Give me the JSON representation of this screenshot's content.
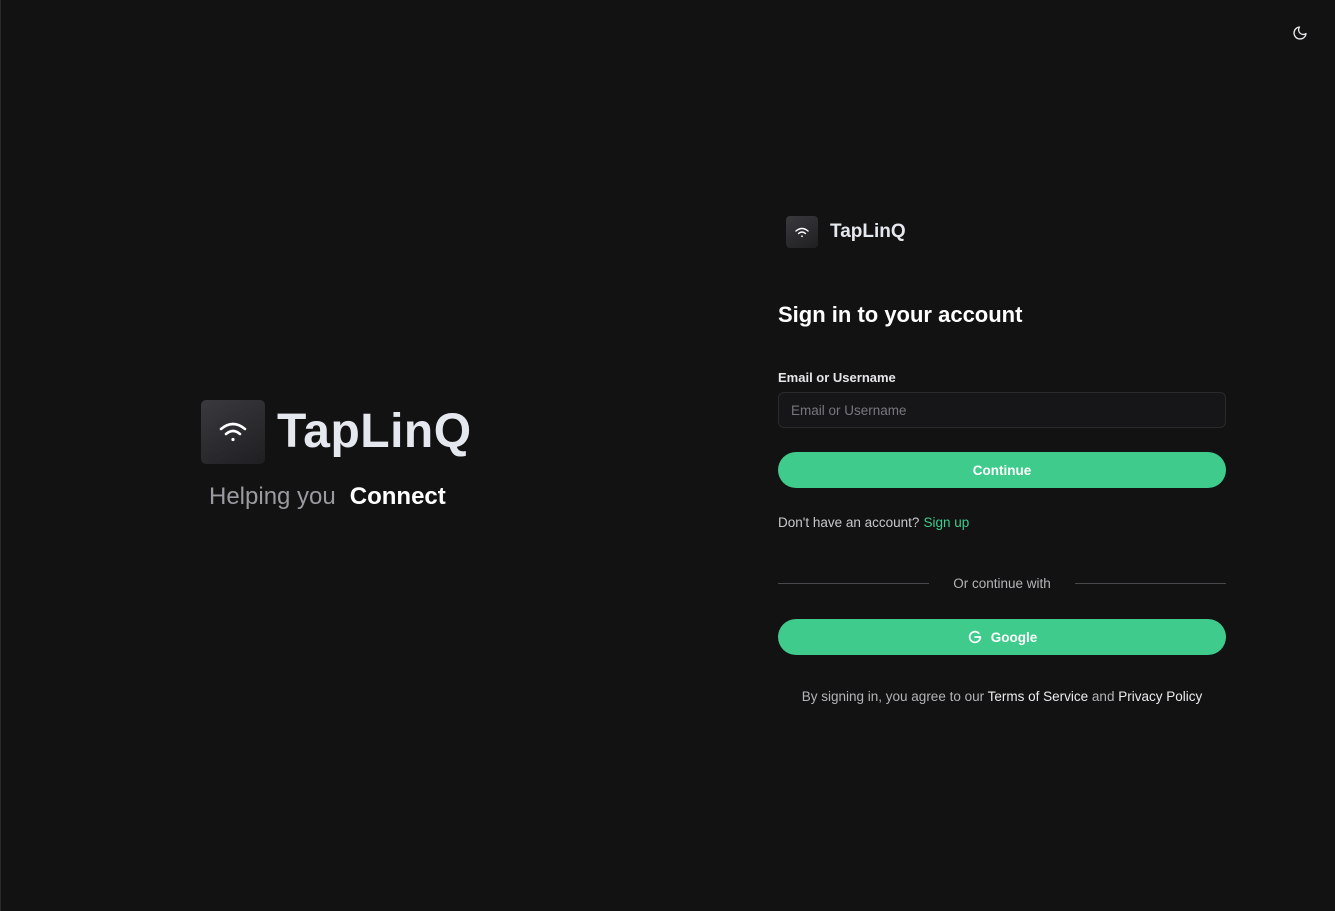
{
  "app": {
    "name": "TapLinQ"
  },
  "hero": {
    "tagline_muted": "Helping you",
    "tagline_strong": "Connect"
  },
  "form": {
    "title": "Sign in to your account",
    "field_label": "Email or Username",
    "field_placeholder": "Email or Username",
    "field_value": "",
    "continue_label": "Continue",
    "no_account_text": "Don't have an account?",
    "signup_link": "Sign up",
    "divider_text": "Or continue with",
    "google_label": "Google",
    "terms_prefix": "By signing in, you agree to our",
    "terms_link": "Terms of Service",
    "terms_and": "and",
    "privacy_link": "Privacy Policy"
  },
  "icons": {
    "theme_toggle": "moon-icon",
    "logo": "wifi-icon",
    "google": "google-icon"
  },
  "colors": {
    "background": "#121212",
    "accent": "#3ecb8b",
    "input_bg": "#161618"
  }
}
